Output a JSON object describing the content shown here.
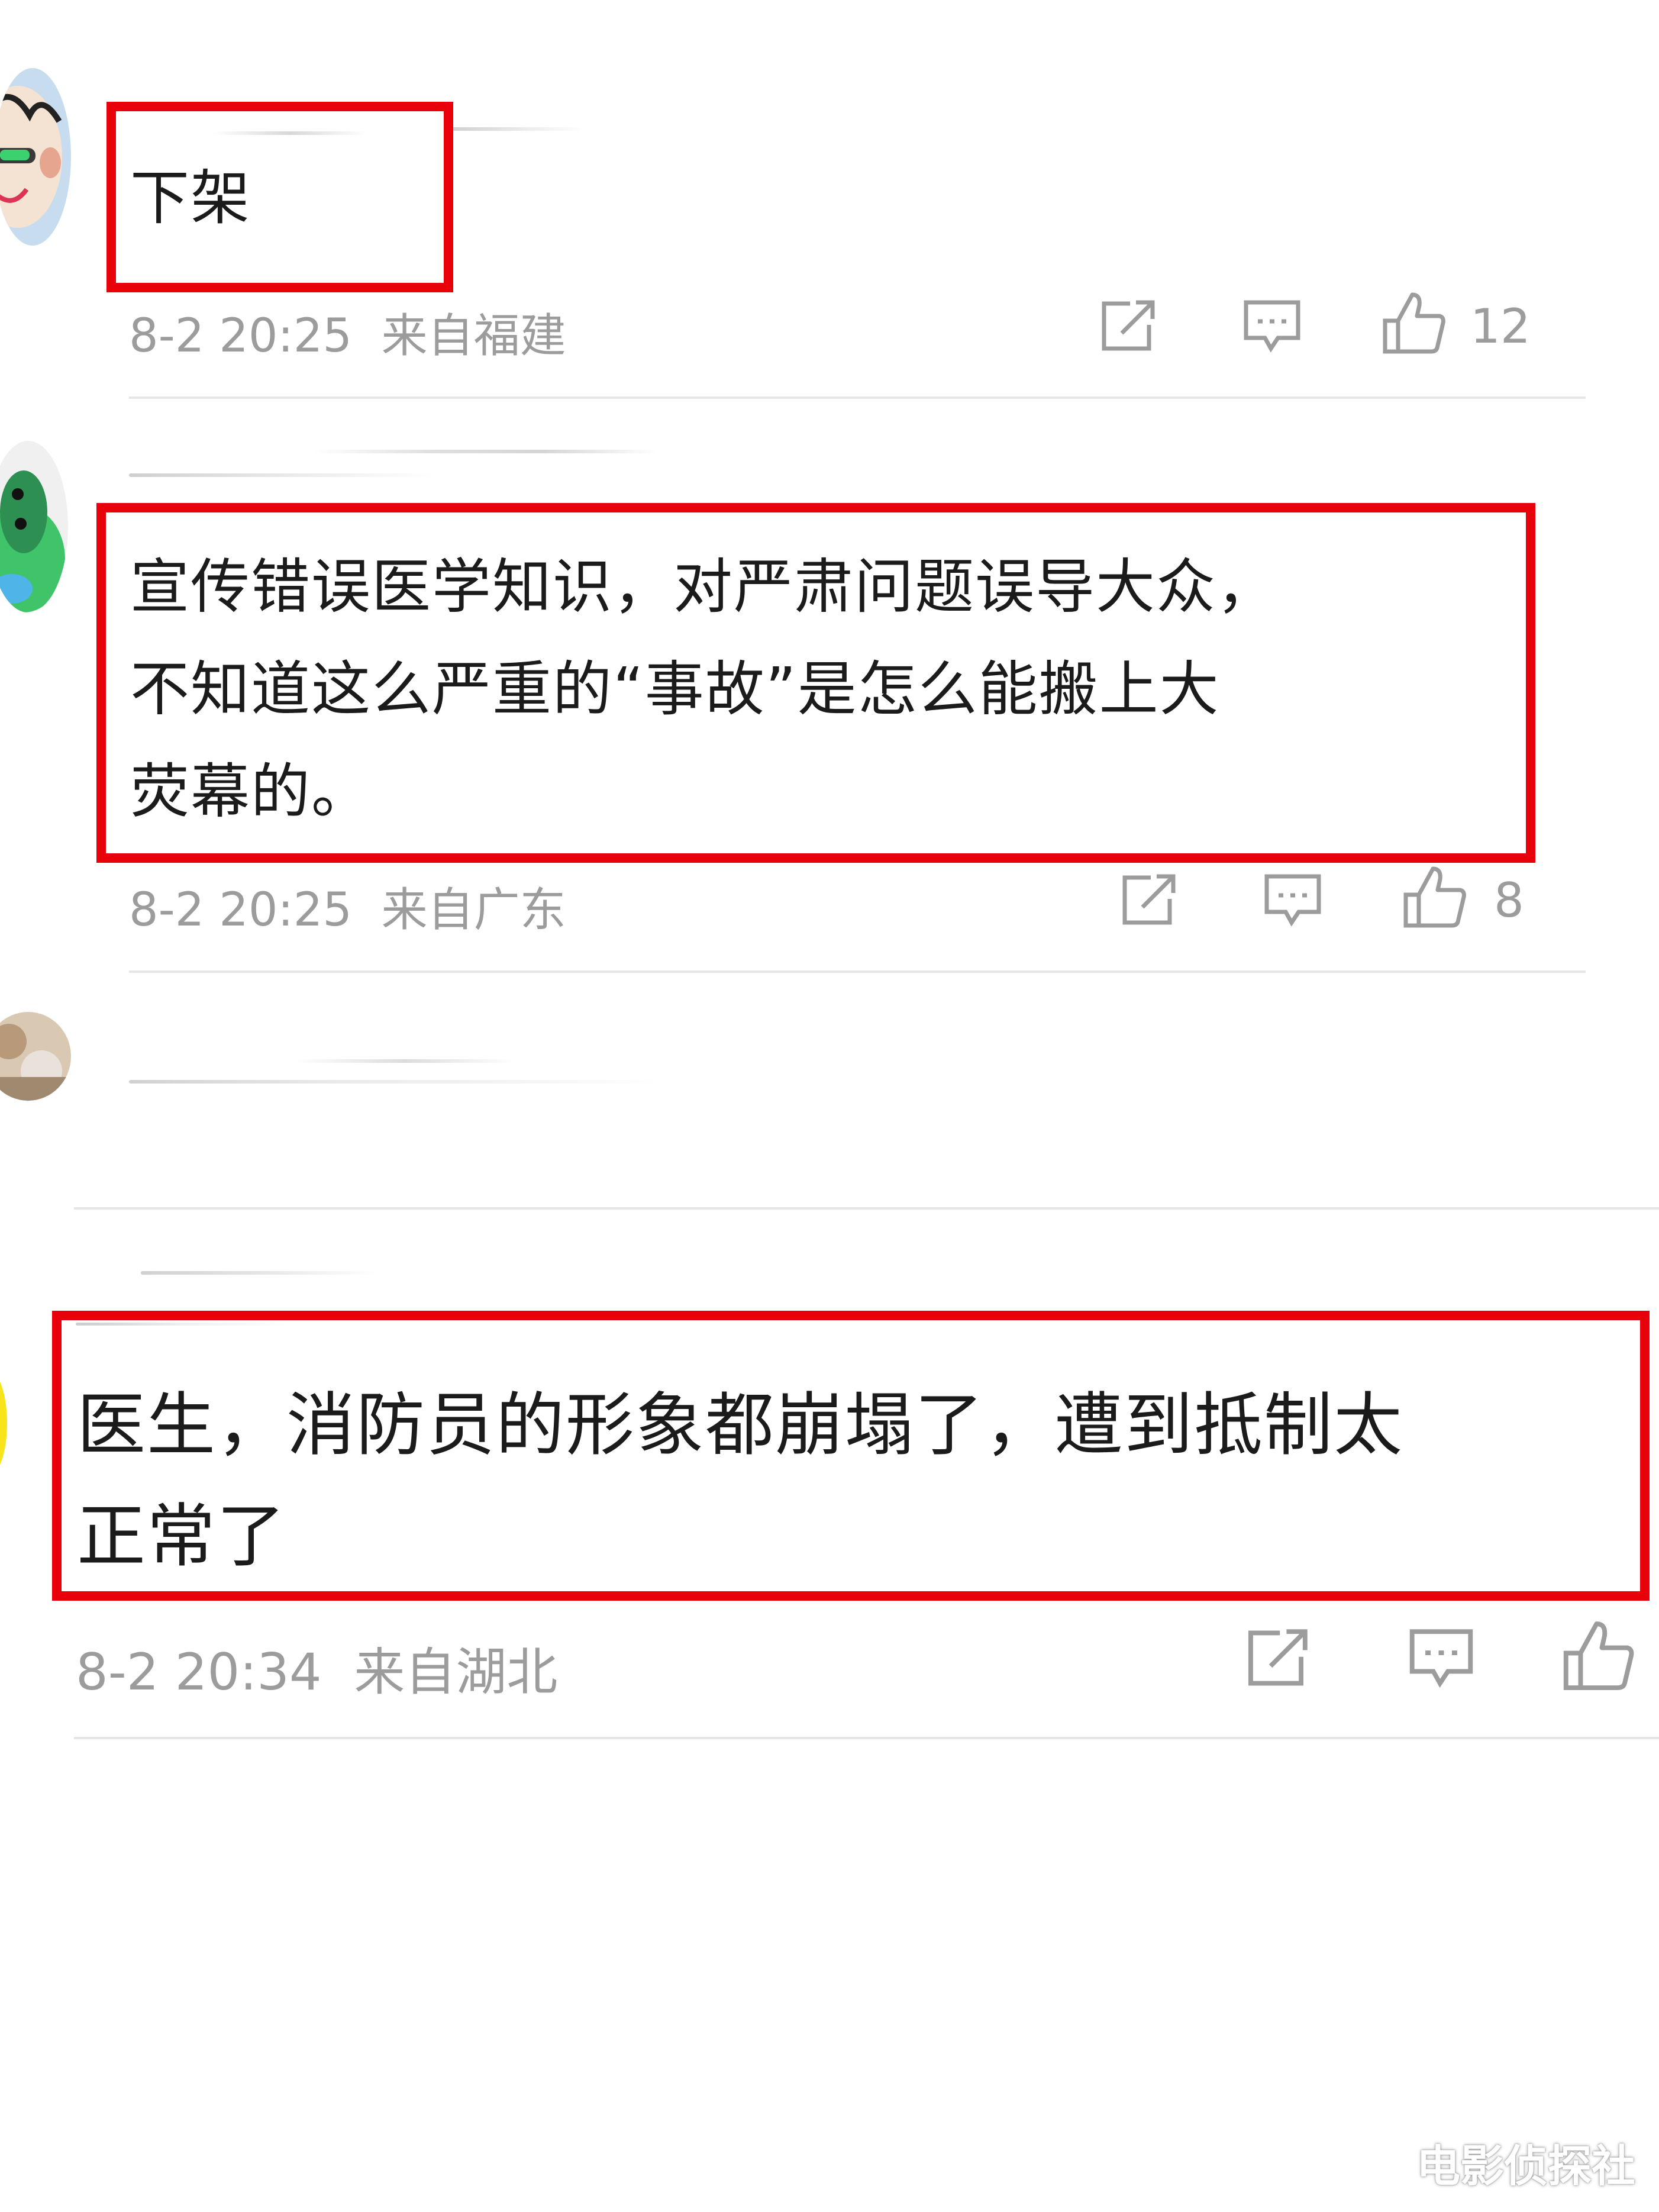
{
  "comments": [
    {
      "text": "下架",
      "time": "8-2 20:25",
      "location": "来自福建",
      "likes": "12"
    },
    {
      "text": "宣传错误医学知识，对严肃问题误导大众，\n不知道这么严重的“事故”是怎么能搬上大\n荧幕的。",
      "time": "8-2 20:25",
      "location": "来自广东",
      "likes": "8"
    },
    {
      "text": "",
      "time": "",
      "location": "",
      "likes": ""
    },
    {
      "text": "医生，消防员的形象都崩塌了，遭到抵制太\n正常了",
      "time": "8-2 20:34",
      "location": "来自湖北",
      "likes": ""
    }
  ],
  "icons": {
    "share": "share-icon",
    "comment": "comment-icon",
    "like": "thumbs-up-icon"
  },
  "colors": {
    "highlight": "#e8000b",
    "meta_text": "#9c9c9c",
    "body_text": "#1b1b1b"
  },
  "watermark": "电影侦探社"
}
